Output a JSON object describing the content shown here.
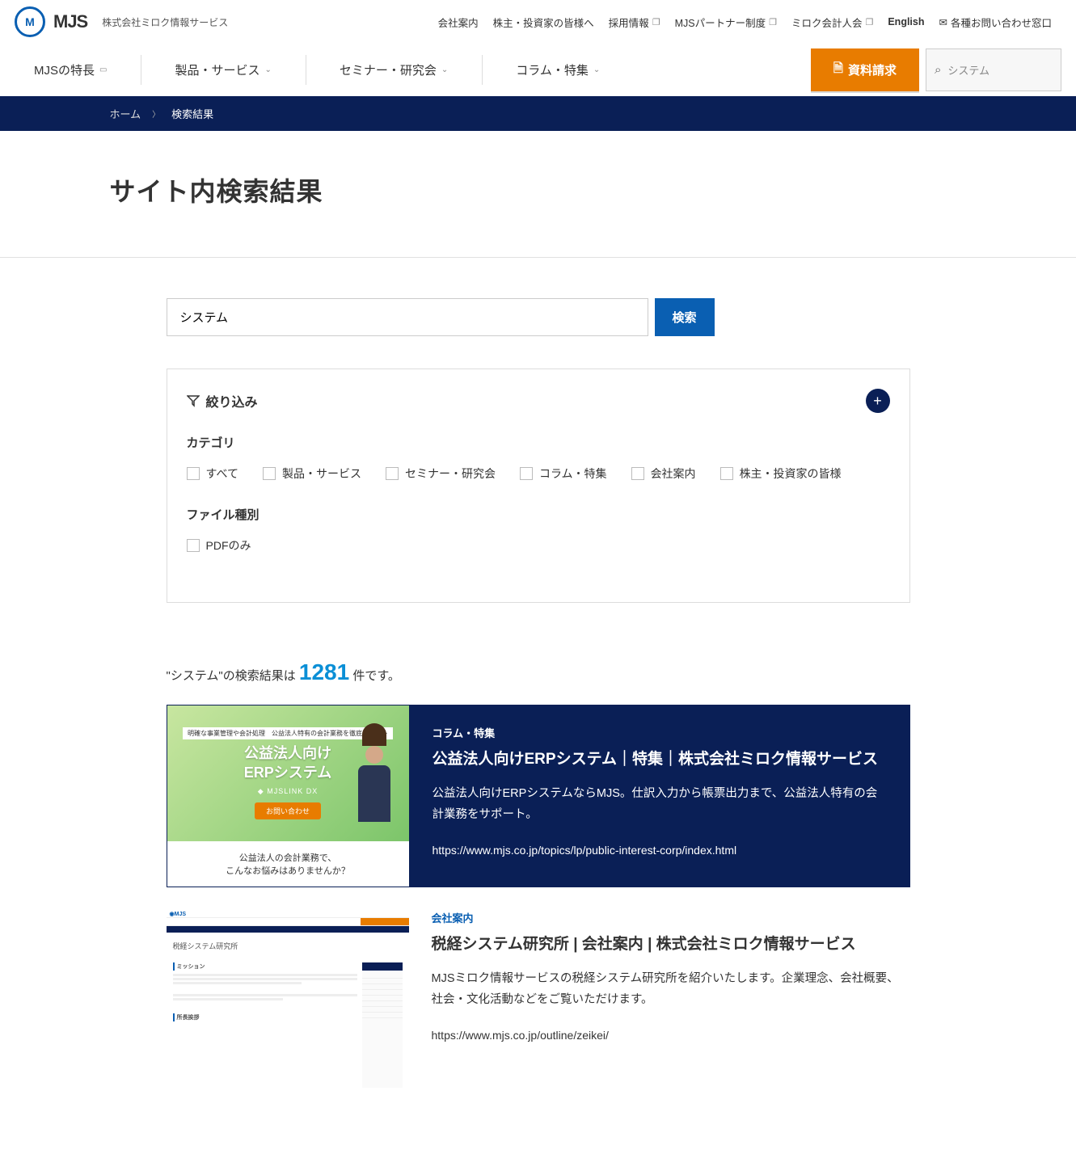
{
  "company_name": "株式会社ミロク情報サービス",
  "top_links": {
    "about": "会社案内",
    "investors": "株主・投資家の皆様へ",
    "recruit": "採用情報",
    "partner": "MJSパートナー制度",
    "meeting": "ミロク会計人会",
    "english": "English",
    "contact": "各種お問い合わせ窓口"
  },
  "nav": {
    "features": "MJSの特長",
    "products": "製品・サービス",
    "seminars": "セミナー・研究会",
    "columns": "コラム・特集"
  },
  "cta_label": "資料請求",
  "header_search_value": "システム",
  "breadcrumb": {
    "home": "ホーム",
    "current": "検索結果"
  },
  "page_title": "サイト内検索結果",
  "search": {
    "value": "システム",
    "button": "検索"
  },
  "filter": {
    "title": "絞り込み",
    "category_label": "カテゴリ",
    "categories": {
      "all": "すべて",
      "products": "製品・サービス",
      "seminars": "セミナー・研究会",
      "columns": "コラム・特集",
      "about": "会社案内",
      "investors": "株主・投資家の皆様"
    },
    "filetype_label": "ファイル種別",
    "pdf_only": "PDFのみ"
  },
  "result_summary": {
    "prefix": "\"システム\"の検索結果は",
    "count": "1281",
    "suffix": "件です。"
  },
  "results": [
    {
      "category": "コラム・特集",
      "title": "公益法人向けERPシステム｜特集｜株式会社ミロク情報サービス",
      "desc": "公益法人向けERPシステムならMJS。仕訳入力から帳票出力まで、公益法人特有の会計業務をサポート。",
      "url": "https://www.mjs.co.jp/topics/lp/public-interest-corp/index.html",
      "thumb": {
        "tagline": "明確な事業管理や会計処理　公益法人特有の会計業務を徹底サポート",
        "title1": "公益法人向け",
        "title2": "ERPシステム",
        "brand": "◆ MJSLINK DX",
        "btn": "お問い合わせ",
        "bottom": "公益法人の会計業務で、\nこんなお悩みはありませんか？"
      }
    },
    {
      "category": "会社案内",
      "title": "税経システム研究所 | 会社案内 | 株式会社ミロク情報サービス",
      "desc": "MJSミロク情報サービスの税経システム研究所を紹介いたします。企業理念、会社概要、社会・文化活動などをご覧いただけます。",
      "url": "https://www.mjs.co.jp/outline/zeikei/",
      "thumb": {
        "title": "税経システム研究所",
        "section1": "ミッション",
        "section2": "所長挨拶"
      }
    }
  ]
}
